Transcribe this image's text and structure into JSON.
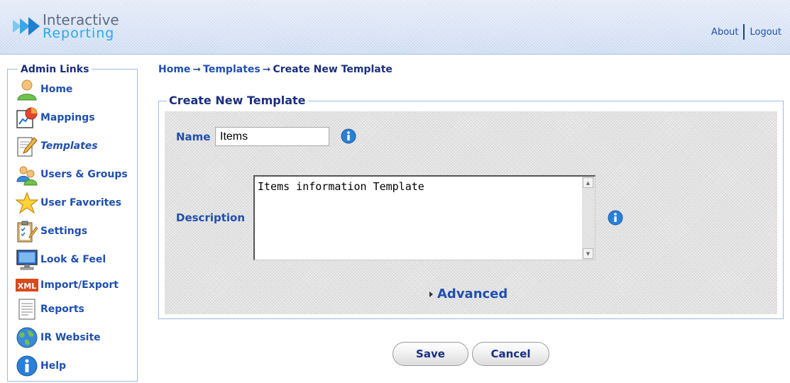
{
  "header": {
    "logo_line1": "Interactive",
    "logo_line2": "Reporting",
    "about_link": "About",
    "logout_link": "Logout"
  },
  "sidebar": {
    "title": "Admin Links",
    "items": [
      {
        "label": "Home",
        "icon": "home-user-icon"
      },
      {
        "label": "Mappings",
        "icon": "mappings-chart-icon"
      },
      {
        "label": "Templates",
        "icon": "templates-pencil-icon",
        "active": true
      },
      {
        "label": "Users & Groups",
        "icon": "users-groups-icon"
      },
      {
        "label": "User Favorites",
        "icon": "star-icon"
      },
      {
        "label": "Settings",
        "icon": "settings-clipboard-icon"
      },
      {
        "label": "Look & Feel",
        "icon": "monitor-icon"
      },
      {
        "label": "Import/Export",
        "icon": "xml-icon"
      },
      {
        "label": "Reports",
        "icon": "report-document-icon"
      },
      {
        "label": "IR Website",
        "icon": "globe-icon"
      },
      {
        "label": "Help",
        "icon": "info-icon"
      }
    ]
  },
  "breadcrumb": {
    "home": "Home",
    "templates": "Templates",
    "current": "Create New Template",
    "separator": "➞"
  },
  "form": {
    "legend": "Create New Template",
    "name_label": "Name",
    "name_value": "Items",
    "description_label": "Description",
    "description_value": "Items information Template",
    "advanced_label": "Advanced"
  },
  "buttons": {
    "save": "Save",
    "cancel": "Cancel"
  },
  "colors": {
    "link_blue": "#1f4fb0",
    "heading_navy": "#1a2f80",
    "panel_border": "#9fb9e2",
    "header_bg": "#c6d6f0"
  }
}
